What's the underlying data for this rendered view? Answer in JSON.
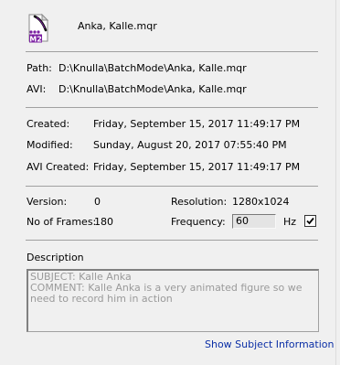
{
  "header": {
    "file_name": "Anka, Kalle.mqr",
    "icon_badge": "M2",
    "icon": "motion-file-icon"
  },
  "paths": {
    "path_label": "Path:",
    "path_value": "D:\\Knulla\\BatchMode\\Anka, Kalle.mqr",
    "avi_label": "AVI:",
    "avi_value": "D:\\Knulla\\BatchMode\\Anka, Kalle.mqr"
  },
  "dates": {
    "created_label": "Created:",
    "created_value": "Friday, September 15, 2017  11:49:17 PM",
    "modified_label": "Modified:",
    "modified_value": "Sunday, August 20, 2017  07:55:40 PM",
    "avi_created_label": "AVI Created:",
    "avi_created_value": "Friday, September 15, 2017  11:49:17 PM"
  },
  "info": {
    "version_label": "Version:",
    "version_value": "0",
    "frames_label": "No of Frames:",
    "frames_value": "180",
    "resolution_label": "Resolution:",
    "resolution_value": "1280x1024",
    "frequency_label": "Frequency:",
    "frequency_value": "60",
    "frequency_unit": "Hz",
    "frequency_checked": true
  },
  "description": {
    "label": "Description",
    "line1": "SUBJECT: Kalle Anka",
    "line2": "COMMENT: Kalle Anka is a very animated figure so we need to record him in action"
  },
  "link": {
    "label": "Show Subject Information"
  },
  "colors": {
    "link": "#0b2fa6",
    "badge": "#7b1fa2",
    "background": "#f0f0f0"
  }
}
